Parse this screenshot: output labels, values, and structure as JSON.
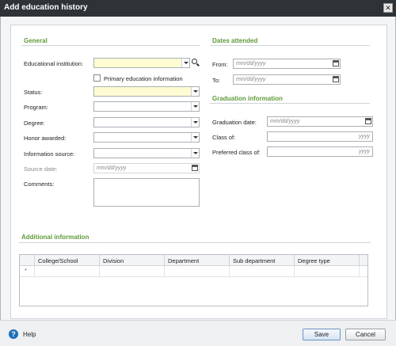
{
  "window": {
    "title": "Add education history",
    "close_glyph": "✕"
  },
  "general": {
    "title": "General",
    "institution_label": "Educational institution:",
    "primary_label": "Primary education information",
    "status_label": "Status:",
    "program_label": "Program:",
    "degree_label": "Degree:",
    "honor_label": "Honor awarded:",
    "info_source_label": "Information source:",
    "source_date_label": "Source date:",
    "source_date_placeholder": "mm/dd/yyyy",
    "comments_label": "Comments:"
  },
  "dates": {
    "title": "Dates attended",
    "from_label": "From:",
    "to_label": "To:",
    "placeholder": "mm/dd/yyyy"
  },
  "graduation": {
    "title": "Graduation information",
    "date_label": "Graduation date:",
    "date_placeholder": "mm/dd/yyyy",
    "class_of_label": "Class of:",
    "preferred_class_label": "Preferred class of:",
    "year_placeholder": "yyyy"
  },
  "additional": {
    "title": "Additional information",
    "columns": [
      "College/School",
      "Division",
      "Department",
      "Sub department",
      "Degree type"
    ],
    "new_row_marker": "*"
  },
  "footer": {
    "help_glyph": "?",
    "help_label": "Help",
    "save_label": "Save",
    "cancel_label": "Cancel"
  },
  "colors": {
    "titlebar": "#2e3338",
    "section_title": "#5e9a3a",
    "required_field": "#fffbd2",
    "help_icon": "#1b6fb8"
  },
  "icons": {
    "dropdown": "chevron-down-icon",
    "search": "search-icon",
    "calendar": "calendar-icon",
    "help": "help-icon",
    "close": "close-icon"
  }
}
